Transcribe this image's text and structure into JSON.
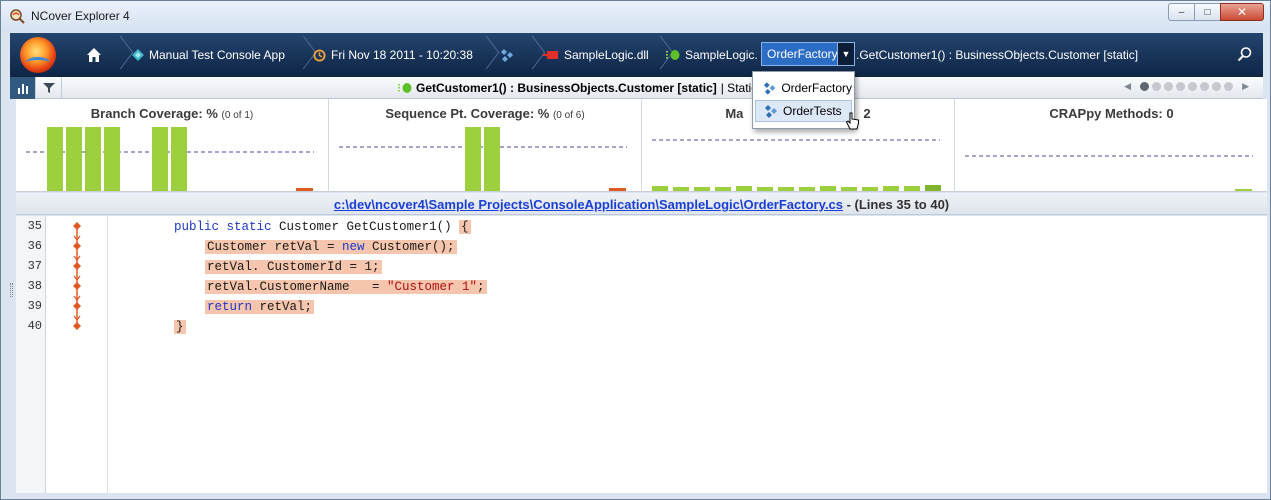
{
  "window": {
    "title": "NCover Explorer 4",
    "min_label": "‒",
    "max_label": "□",
    "close_label": "✕"
  },
  "nav": {
    "home_icon": "home-icon",
    "crumbs": [
      {
        "label": "Manual Test Console App",
        "icon": "project-icon"
      },
      {
        "label": "Fri Nov 18 2011 - 10:20:38",
        "icon": "history-icon"
      },
      {
        "label": "",
        "icon": "modules-icon"
      },
      {
        "label": "SampleLogic.dll",
        "icon": "assembly-icon"
      },
      {
        "label": "SampleLogic.",
        "icon": "namespace-icon"
      }
    ],
    "selected_class": "OrderFactory",
    "method_crumb": ".GetCustomer1() : BusinessObjects.Customer [static]",
    "search_icon": "search-icon"
  },
  "subbar": {
    "method_title": "GetCustomer1() : BusinessObjects.Customer [static]",
    "method_suffix": "| Statio",
    "pager_dots": 8,
    "pager_active": 0
  },
  "charts": [
    {
      "title": "Branch Coverage: %",
      "sub": "(0 of 1)"
    },
    {
      "title": "Sequence Pt. Coverage: %",
      "sub": "(0 of 6)"
    },
    {
      "title": "Ma",
      "sub": "",
      "tail": "2"
    },
    {
      "title": "CRAPpy Methods: 0",
      "sub": ""
    }
  ],
  "path": {
    "file": "c:\\dev\\ncover4\\Sample Projects\\ConsoleApplication\\SampleLogic\\OrderFactory.cs",
    "range": "- (Lines 35 to 40)"
  },
  "code": {
    "line_numbers": [
      "35",
      "36",
      "37",
      "38",
      "39",
      "40"
    ]
  },
  "dropdown": {
    "items": [
      {
        "label": "OrderFactory",
        "icon": "class-icon"
      },
      {
        "label": "OrderTests",
        "icon": "class-icon"
      }
    ]
  },
  "colors": {
    "nav_bg": "#1b355a",
    "bar_green": "#9bcf3e",
    "uncovered": "#f5c6ad",
    "branch_marker": "#e05a25"
  }
}
